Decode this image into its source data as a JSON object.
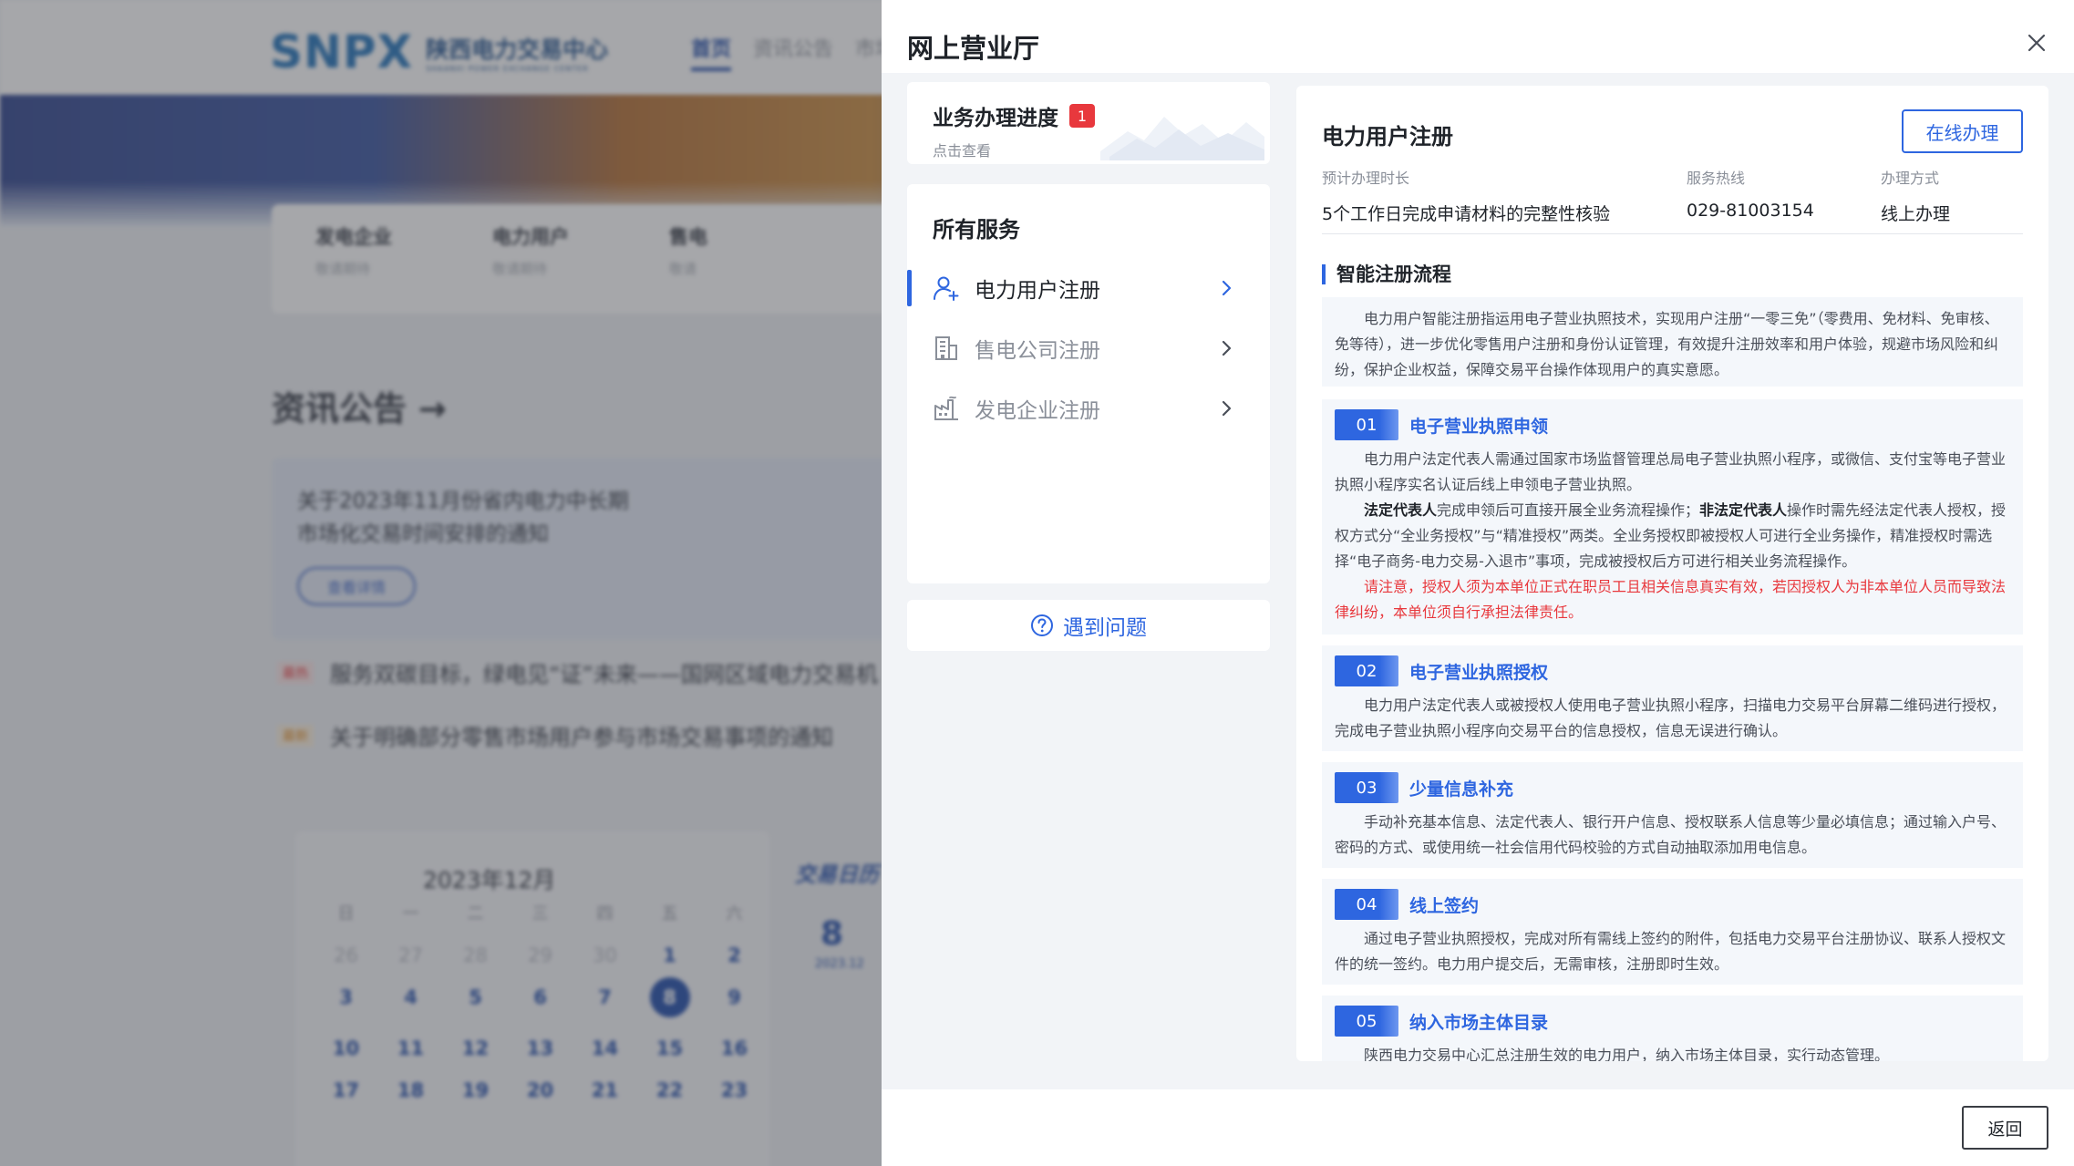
{
  "background": {
    "logo_mark": "SNPX",
    "logo_cn": "陕西电力交易中心",
    "logo_en": "SHAANXI POWER EXCHANGE CENTER",
    "nav": [
      "首页",
      "资讯公告",
      "市场"
    ],
    "cards": [
      {
        "title": "发电企业",
        "sub": "敬请期待"
      },
      {
        "title": "电力用户",
        "sub": "敬请期待"
      },
      {
        "title": "售电",
        "sub": "敬请"
      }
    ],
    "news_title": "资讯公告 →",
    "news_card_title": "关于2023年11月份省内电力中长期市场化交易时间安排的通知",
    "news_card_button": "查看详情",
    "news_lines": [
      {
        "tag": "最热",
        "text": "服务双碳目标，绿电见“证”未来——国网区域电力交易机"
      },
      {
        "tag": "最新",
        "text": "关于明确部分零售市场用户参与市场交易事项的通知"
      }
    ],
    "calendar_title": "2023年12月",
    "calendar_weekdays": [
      "日",
      "一",
      "二",
      "三",
      "四",
      "五",
      "六"
    ],
    "calendar_days": [
      "26",
      "27",
      "28",
      "29",
      "30",
      "1",
      "2",
      "3",
      "4",
      "5",
      "6",
      "7",
      "8",
      "9",
      "10",
      "11",
      "12",
      "13",
      "14",
      "15",
      "16",
      "17",
      "18",
      "19",
      "20",
      "21",
      "22",
      "23"
    ],
    "calendar_side_title": "交易日历",
    "calendar_side_day": "8",
    "calendar_side_month": "2023.12"
  },
  "drawer": {
    "title": "网上营业厅",
    "progress": {
      "title": "业务办理进度",
      "badge": "1",
      "sub": "点击查看"
    },
    "services_title": "所有服务",
    "services": [
      {
        "label": "电力用户注册",
        "icon": "user-add-icon"
      },
      {
        "label": "售电公司注册",
        "icon": "building-icon"
      },
      {
        "label": "发电企业注册",
        "icon": "factory-icon"
      }
    ],
    "help_label": "遇到问题",
    "detail": {
      "title": "电力用户注册",
      "online_button": "在线办理",
      "meta": [
        {
          "key": "预计办理时长",
          "value": "5个工作日完成申请材料的完整性核验"
        },
        {
          "key": "服务热线",
          "value": "029-81003154"
        },
        {
          "key": "办理方式",
          "value": "线上办理"
        }
      ],
      "section_title": "智能注册流程",
      "intro": "电力用户智能注册指运用电子营业执照技术，实现用户注册“一零三免”（零费用、免材料、免审核、免等待），进一步优化零售用户注册和身份认证管理，有效提升注册效率和用户体验，规避市场风险和纠纷，保护企业权益，保障交易平台操作体现用户的真实意愿。",
      "steps": [
        {
          "num": "01",
          "name": "电子营业执照申领",
          "p1": "电力用户法定代表人需通过国家市场监督管理总局电子营业执照小程序，或微信、支付宝等电子营业执照小程序实名认证后线上申领电子营业执照。",
          "p2_b1": "法定代表人",
          "p2_t1": "完成申领后可直接开展全业务流程操作；",
          "p2_b2": "非法定代表人",
          "p2_t2": "操作时需先经法定代表人授权，授权方式分“全业务授权”与“精准授权”两类。全业务授权即被授权人可进行全业务操作，精准授权时需选择“电子商务-电力交易-入退市”事项，完成被授权后方可进行相关业务流程操作。",
          "warn": "请注意，授权人须为本单位正式在职员工且相关信息真实有效，若因授权人为非本单位人员而导致法律纠纷，本单位须自行承担法律责任。"
        },
        {
          "num": "02",
          "name": "电子营业执照授权",
          "p1": "电力用户法定代表人或被授权人使用电子营业执照小程序，扫描电力交易平台屏幕二维码进行授权，完成电子营业执照小程序向交易平台的信息授权，信息无误进行确认。"
        },
        {
          "num": "03",
          "name": "少量信息补充",
          "p1": "手动补充基本信息、法定代表人、银行开户信息、授权联系人信息等少量必填信息；通过输入户号、密码的方式、或使用统一社会信用代码校验的方式自动抽取添加用电信息。"
        },
        {
          "num": "04",
          "name": "线上签约",
          "p1": "通过电子营业执照授权，完成对所有需线上签约的附件，包括电力交易平台注册协议、联系人授权文件的统一签约。电力用户提交后，无需审核，注册即时生效。"
        },
        {
          "num": "05",
          "name": "纳入市场主体目录",
          "p1": "陕西电力交易中心汇总注册生效的电力用户，纳入市场主体目录，实行动态管理。"
        }
      ]
    },
    "back_button": "返回"
  },
  "colors": {
    "accent": "#2e66e0",
    "warn": "#e8383d",
    "badge": "#e8383d"
  }
}
